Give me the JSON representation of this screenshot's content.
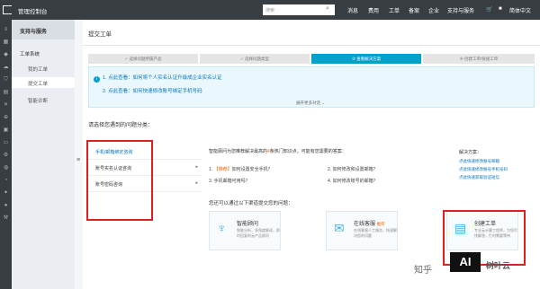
{
  "topbar": {
    "brand": "管理控制台",
    "search_placeholder": "搜索",
    "nav": [
      "消息",
      "费用",
      "工单",
      "备案",
      "企业",
      "支持与服务",
      "简体中文"
    ],
    "colors": {
      "bar": "#373d41",
      "accent": "#00a2ca"
    }
  },
  "sidebar": {
    "title": "支持与服务",
    "group": "工单系统",
    "items": [
      "我的工单",
      "提交工单",
      "智能诊断"
    ]
  },
  "main": {
    "page_title": "提交工单",
    "steps": [
      "选择问题所属产品",
      "选择问题类型",
      "查看解决方案",
      "创建工单/快速工单"
    ],
    "notices": [
      {
        "prefix": "1. 点此查看：",
        "text": "如何将个人实名认证升级成企业实名认证"
      },
      {
        "prefix": "2. 点此查看：",
        "text": "如何快速修改账号绑定手机号码"
      }
    ],
    "more": "展开更多对话",
    "prompt": "请选择您遇到的问题分类：",
    "categories": [
      "手机/邮箱绑定咨询",
      "账号实名认证咨询",
      "账号密码咨询"
    ],
    "hint_prefix": "智能顾问为您推荐解决最高的",
    "hint_count": "4",
    "hint_suffix": "条热门知识点，可能有您需要的答案：",
    "questions": [
      {
        "num": "1.",
        "tag": "【推荐】",
        "text": "如何设置安全手机？"
      },
      {
        "num": "2.",
        "tag": "",
        "text": "如何修改和设置邮箱？"
      },
      {
        "num": "3.",
        "tag": "",
        "text": "手机邮箱可用吗？"
      },
      {
        "num": "4.",
        "tag": "",
        "text": "如何修改账号的邮箱？"
      }
    ],
    "solution_title": "解决方案：",
    "solutions": [
      "点此快速修改账号邮箱",
      "点此快速修改账号手机号码",
      "点此快速获取验证短信"
    ],
    "alt_prompt": "您还可以通过以下渠道提交您的问题：",
    "cards": [
      {
        "title": "智能顾问",
        "desc": "智能分析，多角度解读，即时回复的云产品顾问"
      },
      {
        "title": "在线客服",
        "badge": "推荐",
        "desc": "在线客服人工服务，快速解决您的问题"
      },
      {
        "title": "创建工单",
        "desc": "专业云计算工程师，为您尽快解答，忙时需要等待"
      }
    ]
  },
  "watermark": {
    "site": "知乎",
    "logo": "AI",
    "name": "树叶云"
  }
}
